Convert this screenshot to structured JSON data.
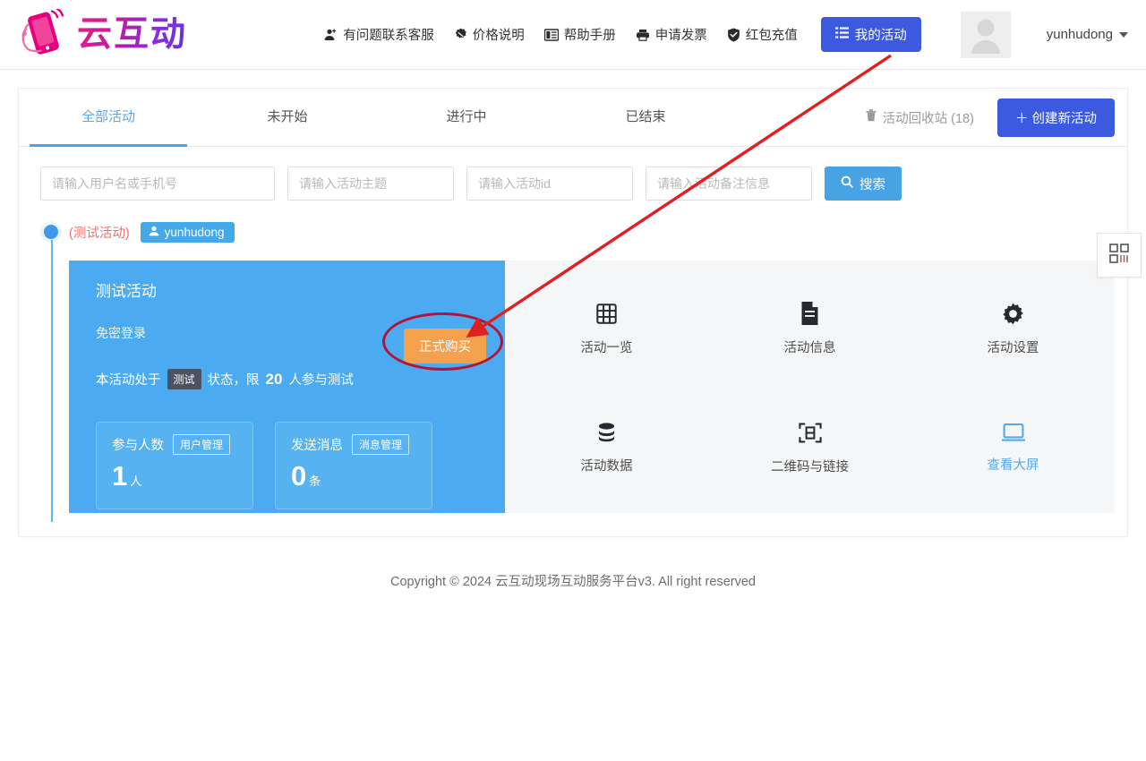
{
  "header": {
    "logo_text": "云互动",
    "logo_icon": "hand-phone-signal-icon",
    "nav": [
      {
        "label": "有问题联系客服",
        "icon": "contact-person-icon"
      },
      {
        "label": "价格说明",
        "icon": "price-tag-icon"
      },
      {
        "label": "帮助手册",
        "icon": "book-icon"
      },
      {
        "label": "申请发票",
        "icon": "printer-icon"
      },
      {
        "label": "红包充值",
        "icon": "shield-check-icon"
      }
    ],
    "my_activity_button": "我的活动",
    "my_activity_icon": "list-icon",
    "avatar_icon": "user-avatar-icon",
    "user_name": "yunhudong",
    "caret_icon": "chevron-down-icon"
  },
  "tabs": [
    {
      "label": "全部活动",
      "active": true
    },
    {
      "label": "未开始",
      "active": false
    },
    {
      "label": "进行中",
      "active": false
    },
    {
      "label": "已结束",
      "active": false
    }
  ],
  "toolbar": {
    "recycle_label": "活动回收站 (18)",
    "recycle_icon": "trash-icon",
    "create_label": "创建新活动",
    "create_icon": "plus-icon"
  },
  "search": {
    "fields": [
      {
        "placeholder": "请输入用户名或手机号",
        "value": ""
      },
      {
        "placeholder": "请输入活动主题",
        "value": ""
      },
      {
        "placeholder": "请输入活动id",
        "value": ""
      },
      {
        "placeholder": "请输入活动备注信息",
        "value": ""
      }
    ],
    "button_label": "搜索",
    "button_icon": "search-icon"
  },
  "activity": {
    "status_dot": "status-dot-blue",
    "test_label": "(测试活动)",
    "owner_badge": "yunhudong",
    "owner_icon": "user-icon",
    "title": "测试活动",
    "subtitle": "免密登录",
    "status_prefix": "本活动处于",
    "status_chip": "测试",
    "status_middle": "状态，限",
    "status_limit": "20",
    "status_suffix": "人参与测试",
    "buy_button": "正式购买",
    "stats": [
      {
        "label": "参与人数",
        "action": "用户管理",
        "value": "1",
        "unit": "人"
      },
      {
        "label": "发送消息",
        "action": "消息管理",
        "value": "0",
        "unit": "条"
      }
    ],
    "tools": [
      {
        "label": "活动一览",
        "icon": "grid-icon",
        "highlight": false
      },
      {
        "label": "活动信息",
        "icon": "document-icon",
        "highlight": false
      },
      {
        "label": "活动设置",
        "icon": "gear-icon",
        "highlight": false
      },
      {
        "label": "活动数据",
        "icon": "database-icon",
        "highlight": false
      },
      {
        "label": "二维码与链接",
        "icon": "qr-scan-icon",
        "highlight": false
      },
      {
        "label": "查看大屏",
        "icon": "monitor-icon",
        "highlight": true
      }
    ],
    "side_tab_icon": "qr-code-icon"
  },
  "footer": {
    "copyright": "Copyright © 2024 云互动现场互动服务平台v3. All right reserved"
  },
  "annotation": {
    "arrow_color": "#e02020",
    "circle_color": "#b01539",
    "arrow_label": "red-pointer-arrow"
  },
  "colors": {
    "primary_blue": "#3b5ae0",
    "card_blue": "#4cabf0",
    "accent_blue": "#47a3e3",
    "orange": "#f4a14e",
    "red_text": "#f0706e"
  }
}
